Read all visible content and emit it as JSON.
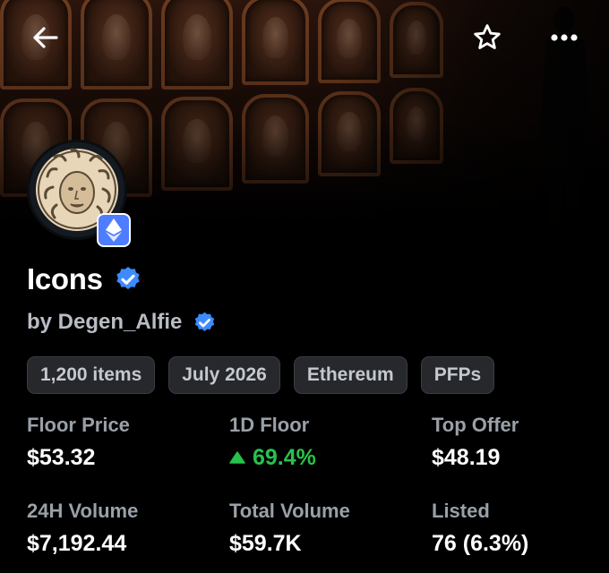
{
  "collection": {
    "name": "Icons",
    "creator": "by Degen_Alfie",
    "chain_icon": "ethereum-icon",
    "verified_icon": "verified-check-icon",
    "avatar_icon": "medusa-head-icon"
  },
  "toolbar": {
    "back_icon": "arrow-left-icon",
    "favorite_icon": "star-outline-icon",
    "more_icon": "more-horizontal-icon"
  },
  "chips": [
    "1,200 items",
    "July 2026",
    "Ethereum",
    "PFPs"
  ],
  "stats": {
    "floor_price": {
      "label": "Floor Price",
      "value": "$53.32"
    },
    "floor_1d": {
      "label": "1D Floor",
      "value": "69.4%",
      "direction": "up"
    },
    "top_offer": {
      "label": "Top Offer",
      "value": "$48.19"
    },
    "volume_24h": {
      "label": "24H Volume",
      "value": "$7,192.44"
    },
    "total_volume": {
      "label": "Total Volume",
      "value": "$59.7K"
    },
    "listed": {
      "label": "Listed",
      "value": "76 (6.3%)"
    }
  },
  "colors": {
    "positive": "#27c24c",
    "verified": "#3d8bff",
    "chain_badge": "#4e7dff",
    "chip_bg": "#26282c",
    "label": "#9aa0a8"
  }
}
